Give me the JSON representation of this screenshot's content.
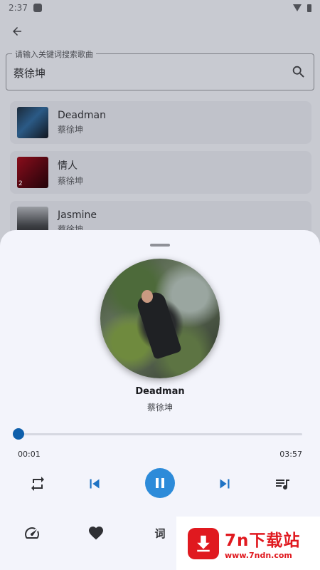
{
  "status_bar": {
    "time": "2:37"
  },
  "search": {
    "label": "请输入关键词搜索歌曲",
    "value": "蔡徐坤"
  },
  "results": [
    {
      "title": "Deadman",
      "artist": "蔡徐坤",
      "cover_badge": ""
    },
    {
      "title": "情人",
      "artist": "蔡徐坤",
      "cover_badge": "2"
    },
    {
      "title": "Jasmine",
      "artist": "蔡徐坤",
      "cover_badge": ""
    }
  ],
  "player": {
    "title": "Deadman",
    "artist": "蔡徐坤",
    "elapsed": "00:01",
    "duration": "03:57",
    "progress_fraction": 0.004,
    "state": "playing"
  },
  "actions": {
    "lyrics_label": "词"
  },
  "watermark": {
    "main": "7n下载站",
    "sub": "www.7ndn.com"
  },
  "colors": {
    "accent": "#2d8bd9",
    "progress": "#0f5fab",
    "sheet": "#f3f4fb",
    "watermark_red": "#e0191f"
  },
  "icons": [
    "arrow-back-icon",
    "search-icon",
    "repeat-icon",
    "skip-previous-icon",
    "pause-icon",
    "skip-next-icon",
    "queue-music-icon",
    "speed-icon",
    "heart-icon"
  ]
}
